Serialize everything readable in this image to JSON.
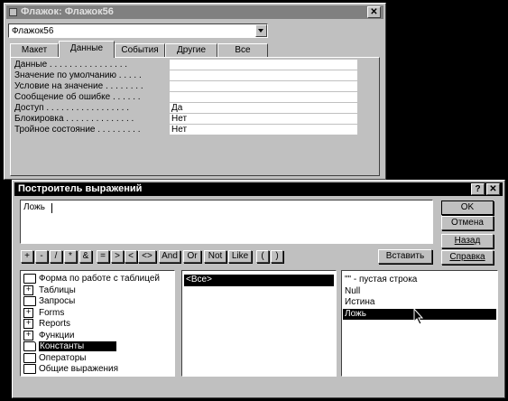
{
  "prop_window": {
    "title": "Флажок: Флажок56",
    "close_glyph": "✕",
    "object_select_value": "Флажок56",
    "tabs": [
      "Макет",
      "Данные",
      "События",
      "Другие",
      "Все"
    ],
    "active_tab_index": 1,
    "properties": [
      {
        "label": "Данные . . . . . . . . . . . . . . . .",
        "value": ""
      },
      {
        "label": "Значение по умолчанию . . . . .",
        "value": ""
      },
      {
        "label": "Условие на значение . . . . . . . .",
        "value": ""
      },
      {
        "label": "Сообщение об ошибке . . . . . .",
        "value": ""
      },
      {
        "label": "Доступ . . . . . . . . . . . . . . . . .",
        "value": "Да"
      },
      {
        "label": "Блокировка . . . . . . . . . . . . . .",
        "value": "Нет"
      },
      {
        "label": "Тройное состояние . . . . . . . . .",
        "value": "Нет"
      }
    ]
  },
  "builder": {
    "title": "Построитель выражений",
    "help_glyph": "?",
    "close_glyph": "✕",
    "expression": "Ложь",
    "buttons": {
      "ok": "OK",
      "cancel": "Отмена",
      "back": "Назад",
      "help": "Справка",
      "insert": "Вставить"
    },
    "operators": [
      "+",
      "-",
      "/",
      "*",
      "&",
      "=",
      ">",
      "<",
      "<>",
      "And",
      "Or",
      "Not",
      "Like",
      "(",
      ")"
    ],
    "folders": [
      {
        "label": "Форма по работе с таблицей",
        "icon": "folder-icon"
      },
      {
        "label": "Таблицы",
        "icon": "plus-icon"
      },
      {
        "label": "Запросы",
        "icon": "folder-icon"
      },
      {
        "label": "Forms",
        "icon": "plus-icon"
      },
      {
        "label": "Reports",
        "icon": "plus-icon"
      },
      {
        "label": "Функции",
        "icon": "plus-icon"
      },
      {
        "label": "Константы",
        "icon": "open-folder-icon",
        "selected": true
      },
      {
        "label": "Операторы",
        "icon": "folder-icon"
      },
      {
        "label": "Общие выражения",
        "icon": "folder-icon"
      }
    ],
    "middle_items": [
      {
        "label": "<Все>",
        "selected": true
      }
    ],
    "right_items": [
      {
        "label": "\"\" - пустая строка"
      },
      {
        "label": "Null"
      },
      {
        "label": "Истина"
      },
      {
        "label": "Ложь",
        "selected": true
      }
    ]
  },
  "colors": {
    "title_bar_inactive": "#808080",
    "title_bar_active": "#000000",
    "face": "#c0c0c0",
    "background": "#000000"
  }
}
